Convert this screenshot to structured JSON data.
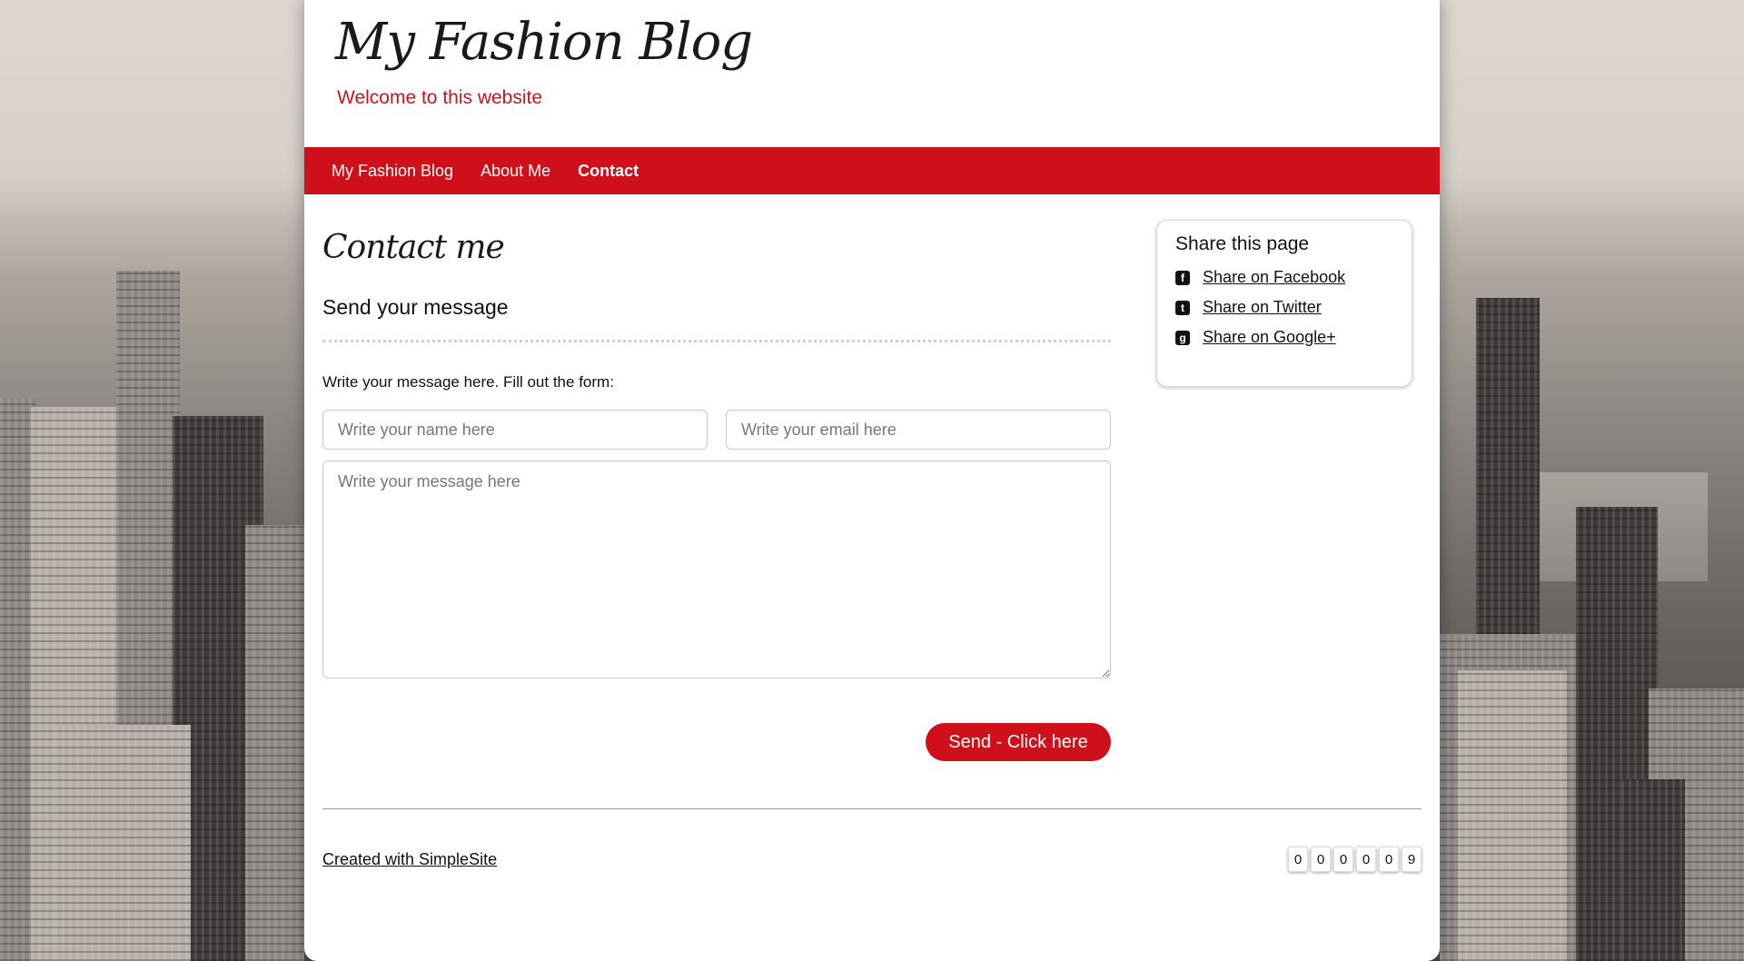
{
  "site": {
    "title": "My Fashion Blog",
    "tagline": "Welcome to this website"
  },
  "nav": {
    "items": [
      {
        "label": "My Fashion Blog",
        "active": false
      },
      {
        "label": "About Me",
        "active": false
      },
      {
        "label": "Contact",
        "active": true
      }
    ]
  },
  "main": {
    "title": "Contact me",
    "heading": "Send your message",
    "intro": "Write your message here. Fill out the form:",
    "form": {
      "name_placeholder": "Write your name here",
      "email_placeholder": "Write your email here",
      "message_placeholder": "Write your message here",
      "send_label": "Send - Click here"
    }
  },
  "share": {
    "title": "Share this page",
    "items": [
      {
        "label": "Share on Facebook",
        "icon": "facebook-icon"
      },
      {
        "label": "Share on Twitter",
        "icon": "twitter-icon"
      },
      {
        "label": "Share on Google+",
        "icon": "google-plus-icon"
      }
    ]
  },
  "footer": {
    "link": "Created with SimpleSite",
    "counter": [
      "0",
      "0",
      "0",
      "0",
      "0",
      "9"
    ]
  },
  "colors": {
    "accent": "#cf0f1a",
    "tagline": "#c9131d"
  }
}
